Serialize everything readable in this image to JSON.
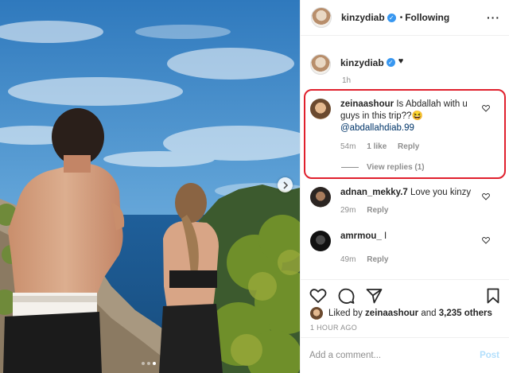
{
  "post": {
    "author": "kinzydiab",
    "follow_dot": "•",
    "follow_label": "Following",
    "more_label": "···"
  },
  "caption": {
    "username": "kinzydiab",
    "text": "♥",
    "time": "1h"
  },
  "comments": [
    {
      "username": "zeinaashour",
      "text": "Is Abdallah with u guys in this trip??😆",
      "mention": "@abdallahdiab.99",
      "time": "54m",
      "likes": "1 like",
      "reply": "Reply",
      "view_replies": "View replies (1)"
    },
    {
      "username": "adnan_mekky.7",
      "text": "Love you kinzy",
      "time": "29m",
      "reply": "Reply"
    },
    {
      "username": "amrmou_",
      "text": "I",
      "time": "49m",
      "reply": "Reply"
    }
  ],
  "likes": {
    "prefix": "Liked by",
    "user": "zeinaashour",
    "middle": "and",
    "count": "3,235 others"
  },
  "timestamp": "1 HOUR AGO",
  "add_comment": {
    "placeholder": "Add a comment...",
    "post_label": "Post"
  },
  "colors": {
    "highlight": "#e0202d",
    "verified": "#3897f0",
    "mention": "#003569",
    "post_disabled": "#b2dffc"
  },
  "icons": [
    "verified-icon",
    "heart-icon",
    "comment-icon",
    "share-icon",
    "bookmark-icon",
    "chevron-right-icon",
    "more-icon"
  ]
}
